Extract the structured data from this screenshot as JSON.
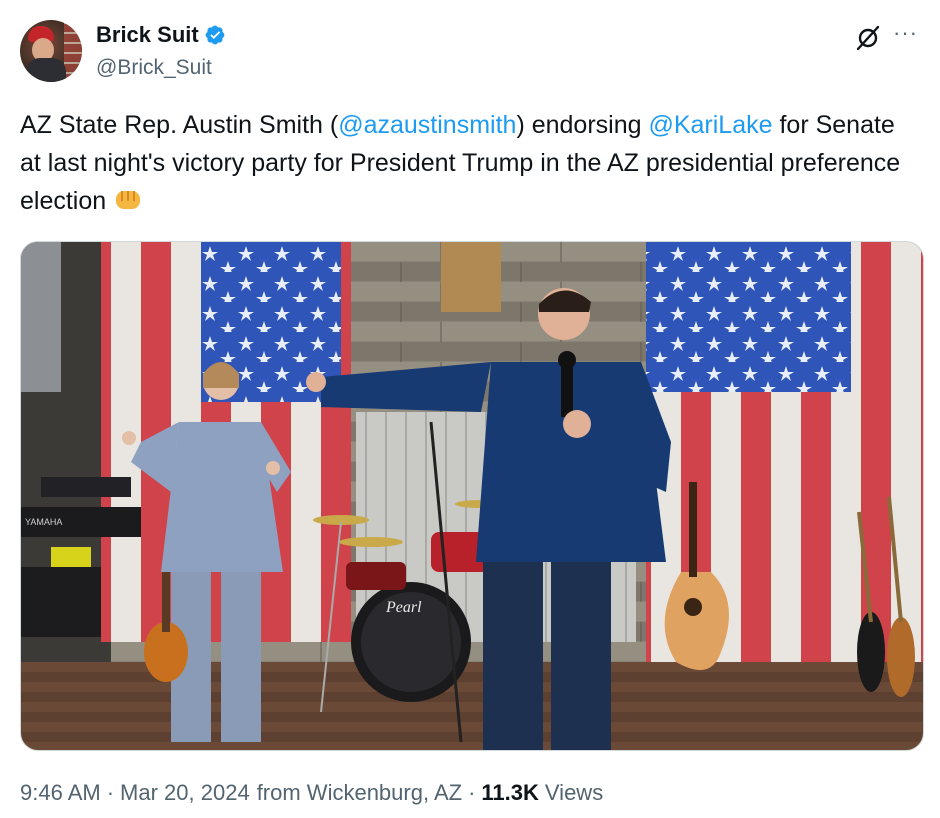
{
  "author": {
    "display_name": "Brick Suit",
    "handle": "@Brick_Suit",
    "verified_color": "#1d9bf0"
  },
  "tweet": {
    "text_part1": "AZ State Rep. Austin Smith (",
    "mention1": "@azaustinsmith",
    "text_part2": ") endorsing ",
    "mention2": "@KariLake",
    "text_part3": " for Senate at last night's victory party for President Trump in the AZ presidential preference election",
    "emoji_icon": "oncoming-fist-icon"
  },
  "media": {
    "microphone_brand_label": "Pearl",
    "keyboard_brand_label": "YAMAHA"
  },
  "footer": {
    "time": "9:46 AM",
    "separator": "·",
    "date": "Mar 20, 2024",
    "location": "from Wickenburg, AZ",
    "views_count": "11.3K",
    "views_label": "Views"
  },
  "colors": {
    "link": "#1d9bf0",
    "text": "#0f1419",
    "secondary": "#536471"
  }
}
